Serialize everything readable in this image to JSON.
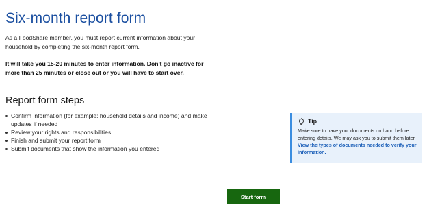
{
  "page": {
    "title": "Six-month report form",
    "intro": "As a FoodShare member, you must report current information about your household by completing the six-month report form.",
    "notice": "It will take you 15-20 minutes to enter information. Don't go inactive for more than 25 minutes or close out or you will have to start over."
  },
  "steps": {
    "heading": "Report form steps",
    "items": [
      {
        "label": "Confirm information (for example: household details and income) and make updates if needed"
      },
      {
        "label": "Review your rights and responsibilities"
      },
      {
        "label": "Finish and submit your report form"
      },
      {
        "label": "Submit documents that show the information you entered"
      }
    ]
  },
  "tip": {
    "icon": "lightbulb-icon",
    "title": "Tip",
    "body": "Make sure to have your documents on hand before entering details. We may ask you to submit them later.",
    "link_label": "View the types of documents needed to verify your information."
  },
  "actions": {
    "start_label": "Start form"
  },
  "colors": {
    "title": "#1b4fa0",
    "button": "#17670f",
    "tip_background": "#e8f1fb",
    "tip_border": "#3a8de0",
    "link": "#1b5fb8"
  }
}
